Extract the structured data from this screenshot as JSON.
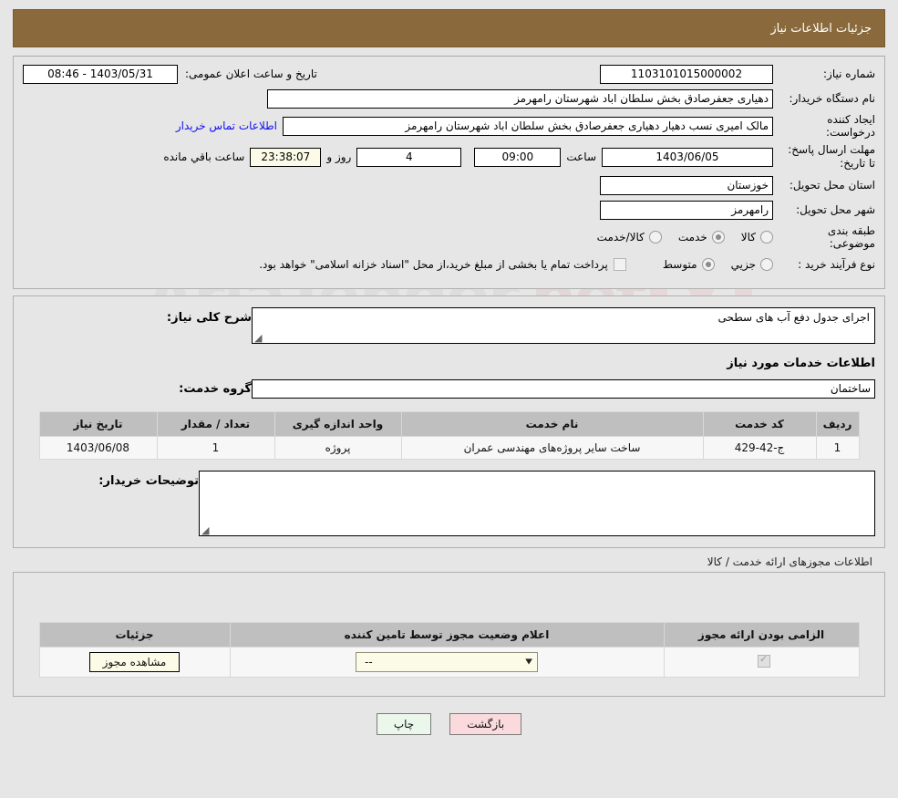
{
  "header": {
    "title": "جزئیات اطلاعات نیاز"
  },
  "form": {
    "need_number_label": "شماره نیاز:",
    "need_number_value": "1103101015000002",
    "announce_label": "تاریخ و ساعت اعلان عمومی:",
    "announce_value": "1403/05/31 - 08:46",
    "buyer_org_label": "نام دستگاه خریدار:",
    "buyer_org_value": "دهیاری جعفرصادق بخش سلطان اباد شهرستان رامهرمز",
    "creator_label": "ایجاد کننده درخواست:",
    "creator_value": "مالک امیری نسب دهیار دهیاری جعفرصادق بخش سلطان اباد شهرستان رامهرمز",
    "contact_link": "اطلاعات تماس خریدار",
    "deadline_label": "مهلت ارسال پاسخ: تا تاریخ:",
    "deadline_date": "1403/06/05",
    "deadline_hour_label": "ساعت",
    "deadline_hour": "09:00",
    "days_value": "4",
    "days_label": "روز و",
    "countdown_value": "23:38:07",
    "countdown_label": "ساعت باقي مانده",
    "province_label": "استان محل تحویل:",
    "province_value": "خوزستان",
    "city_label": "شهر محل تحویل:",
    "city_value": "رامهرمز",
    "category_label": "طبقه بندی موضوعی:",
    "category_options": [
      {
        "label": "کالا",
        "selected": false
      },
      {
        "label": "خدمت",
        "selected": true
      },
      {
        "label": "کالا/خدمت",
        "selected": false
      }
    ],
    "process_label": "نوع فرآیند خرید :",
    "process_options": [
      {
        "label": "جزیي",
        "selected": false
      },
      {
        "label": "متوسط",
        "selected": true
      }
    ],
    "treasury_checked": false,
    "treasury_note": "پرداخت تمام یا بخشی از مبلغ خرید،از محل \"اسناد خزانه اسلامی\" خواهد بود."
  },
  "description": {
    "label": "شرح کلی نیاز:",
    "value": "اجرای جدول دفع آب های سطحی"
  },
  "services_section": {
    "heading": "اطلاعات خدمات مورد نیاز",
    "group_label": "گروه خدمت:",
    "group_value": "ساختمان",
    "columns": [
      "ردیف",
      "کد خدمت",
      "نام خدمت",
      "واحد اندازه گیری",
      "تعداد / مقدار",
      "تاریخ نیاز"
    ],
    "rows": [
      {
        "index": "1",
        "code": "ج-42-429",
        "name": "ساخت سایر پروژه‌های مهندسی عمران",
        "unit": "پروژه",
        "quantity": "1",
        "date": "1403/06/08"
      }
    ]
  },
  "buyer_notes": {
    "label": "توضیحات خریدار:",
    "value": ""
  },
  "permits": {
    "section_label": "اطلاعات مجوزهای ارائه خدمت / کالا",
    "columns": [
      "الزامی بودن ارائه مجوز",
      "اعلام وضعیت مجوز توسط تامین کننده",
      "جزئیات"
    ],
    "rows": [
      {
        "required_checked": true,
        "status_value": "--",
        "details_button": "مشاهده مجوز"
      }
    ]
  },
  "footer": {
    "print_label": "چاپ",
    "back_label": "بازگشت"
  },
  "watermark": {
    "text": "AriaTender",
    "suffix": ".net"
  }
}
